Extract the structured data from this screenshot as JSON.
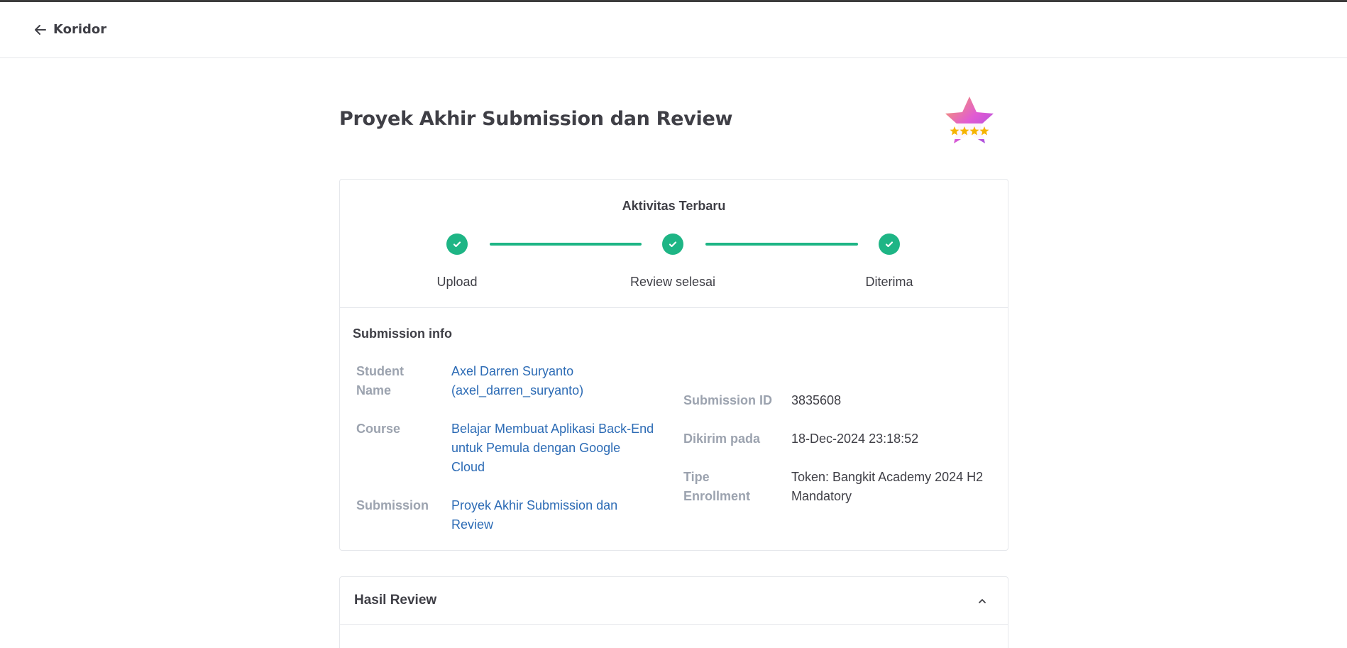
{
  "nav": {
    "back_label": "Koridor"
  },
  "page": {
    "title": "Proyek Akhir Submission dan Review"
  },
  "activity": {
    "title": "Aktivitas Terbaru",
    "steps": [
      {
        "label": "Upload",
        "done": true
      },
      {
        "label": "Review selesai",
        "done": true
      },
      {
        "label": "Diterima",
        "done": true
      }
    ],
    "accent_color": "#1eb585"
  },
  "submission_info": {
    "title": "Submission info",
    "student_name_label": "Student Name",
    "student_name_line1": "Axel Darren Suryanto",
    "student_name_line2": "(axel_darren_suryanto)",
    "course_label": "Course",
    "course_line1": "Belajar Membuat Aplikasi Back-End",
    "course_line2": "untuk Pemula dengan Google",
    "course_line3": "Cloud",
    "submission_label": "Submission",
    "submission_line1": "Proyek Akhir Submission dan",
    "submission_line2": "Review",
    "submission_id_label": "Submission ID",
    "submission_id": "3835608",
    "sent_label": "Dikirim pada",
    "sent_at": "18-Dec-2024 23:18:52",
    "enrollment_label_line1": "Tipe",
    "enrollment_label_line2": "Enrollment",
    "enrollment_line1": "Token: Bangkit Academy 2024 H2",
    "enrollment_line2": "Mandatory",
    "link_color": "#2c6bb5"
  },
  "review": {
    "title": "Hasil Review",
    "icon": "chevron-up-icon"
  },
  "badge": {
    "icon": "star-rating-badge-icon",
    "stars": 4
  }
}
